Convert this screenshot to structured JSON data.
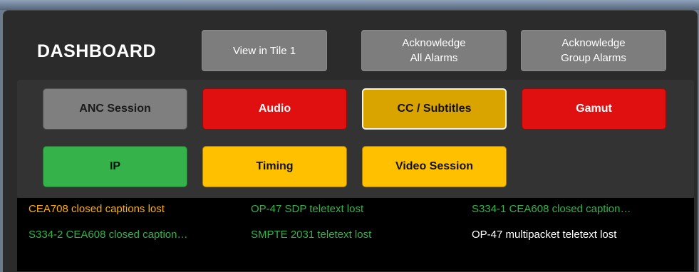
{
  "header": {
    "title": "DASHBOARD",
    "buttons": [
      {
        "label": "View in Tile 1"
      },
      {
        "label": "Acknowledge\nAll Alarms"
      },
      {
        "label": "Acknowledge\nGroup Alarms"
      }
    ]
  },
  "tiles": [
    {
      "label": "ANC Session",
      "status": "inactive",
      "bg": "#7f7f7f",
      "fg": "#1a1a1a"
    },
    {
      "label": "Audio",
      "status": "error",
      "bg": "#e01010",
      "fg": "#ffffff"
    },
    {
      "label": "CC / Subtitles",
      "status": "warning-selected",
      "bg": "#d9a300",
      "fg": "#111111"
    },
    {
      "label": "Gamut",
      "status": "error",
      "bg": "#e01010",
      "fg": "#ffffff"
    },
    {
      "label": "IP",
      "status": "ok",
      "bg": "#35b24a",
      "fg": "#111111"
    },
    {
      "label": "Timing",
      "status": "warning",
      "bg": "#ffc000",
      "fg": "#111111"
    },
    {
      "label": "Video Session",
      "status": "warning",
      "bg": "#ffc000",
      "fg": "#111111"
    }
  ],
  "alarms": [
    {
      "text": "CEA708 closed captions lost",
      "color": "#ffb000"
    },
    {
      "text": "OP-47 SDP teletext lost",
      "color": "#35b24a"
    },
    {
      "text": "S334-1 CEA608 closed caption…",
      "color": "#35b24a"
    },
    {
      "text": "S334-2 CEA608 closed caption…",
      "color": "#35b24a"
    },
    {
      "text": "SMPTE 2031 teletext lost",
      "color": "#35b24a"
    },
    {
      "text": "OP-47 multipacket teletext lost",
      "color": "#ffffff"
    }
  ]
}
